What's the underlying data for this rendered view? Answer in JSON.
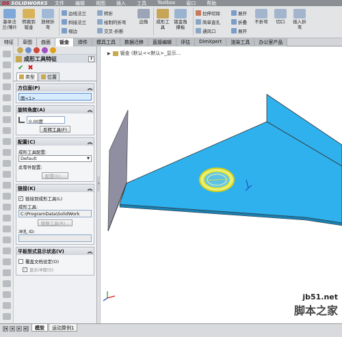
{
  "app": {
    "logo_prefix": "DS",
    "logo_text": "SOLIDWORKS"
  },
  "menu": [
    "文件",
    "编辑",
    "视图",
    "插入",
    "工具",
    "Toolbox",
    "窗口",
    "帮助"
  ],
  "ribbon": {
    "big_buttons": [
      "基体法兰/薄片",
      "转换到钣金",
      "放样折弯",
      "成形工具",
      "钣金角撑板"
    ],
    "small_col1": [
      "边线法兰",
      "斜接法兰",
      "褶边"
    ],
    "small_col2": [
      "转折",
      "绘制的折弯",
      "交叉-折断"
    ],
    "big_corner": "边角",
    "small_col3": [
      "拉伸切除",
      "简单直孔",
      "通风口"
    ],
    "small_col4": [
      "展开",
      "折叠",
      "展开"
    ],
    "big_right": [
      "不折弯",
      "切口",
      "插入折弯"
    ]
  },
  "tabs": [
    "特征",
    "草图",
    "曲面",
    "钣金",
    "焊件",
    "模具工具",
    "数据迁移",
    "直接编辑",
    "评估",
    "DimXpert",
    "渲染工具",
    "办公室产品"
  ],
  "active_tab": "钣金",
  "property_manager": {
    "title": "成形工具特征",
    "help": "?",
    "ok_symbol": "✔",
    "cancel_symbol": "✖",
    "subtabs": [
      "类型",
      "位置"
    ],
    "groups": {
      "face": {
        "title": "方位面(P)",
        "value": "面<1>"
      },
      "rotation": {
        "title": "旋转角度(A)",
        "value": "0.00度",
        "button": "反转工具(F)"
      },
      "config": {
        "title": "配置(C)",
        "label1": "成形工具配置:",
        "select_value": "Default",
        "label2": "此零件配置:",
        "button": "配置(G)..."
      },
      "link": {
        "title": "链接(K)",
        "checkbox_label": "链接到成形工具(L)",
        "tool_label": "成形工具:",
        "path": "C:\\ProgramData\\SolidWork",
        "button": "替换工具(R)...",
        "punch_label": "冲孔 ID:"
      },
      "flat": {
        "title": "平板型式显示状态(V)",
        "override_label": "覆盖文档设定(O)",
        "show_label": "显示冲程(S)"
      }
    }
  },
  "viewport": {
    "breadcrumb": "钣金 (默认<<默认>_显示...",
    "watermark_line1": "jb51.net",
    "watermark_line2": "脚本之家"
  },
  "bottom_tabs": [
    "模型",
    "运动算例1"
  ],
  "colors": {
    "sheet": "#2fb1ee",
    "flange": "#8f8fa1",
    "highlight": "#e6e21c"
  }
}
